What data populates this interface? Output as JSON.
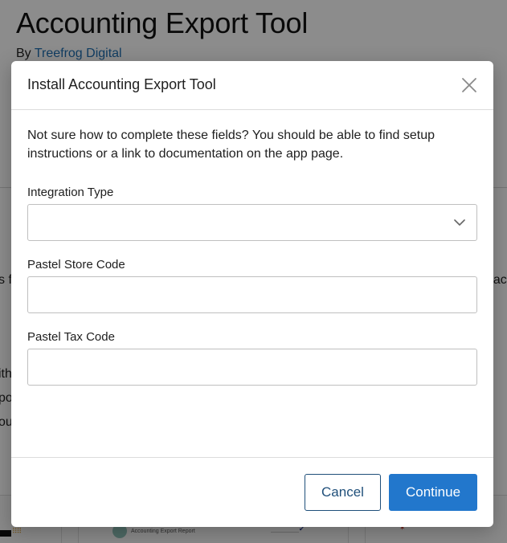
{
  "background": {
    "app_title": "Accounting Export Tool",
    "by_label": "By",
    "developer": "Treefrog Digital",
    "fragments": [
      {
        "text": "s fi",
        "pos": "a"
      },
      {
        "text": "oac",
        "pos": "b"
      },
      {
        "text": "ith",
        "pos": "c"
      },
      {
        "text": "po",
        "pos": "d"
      },
      {
        "text": "ou",
        "pos": "e"
      }
    ],
    "thumbnail_label": "Accounting Export Report"
  },
  "modal": {
    "title": "Install Accounting Export Tool",
    "intro": "Not sure how to complete these fields? You should be able to find setup instructions or a link to documentation on the app page.",
    "fields": {
      "integration_type": {
        "label": "Integration Type",
        "value": ""
      },
      "store_code": {
        "label": "Pastel Store Code",
        "value": ""
      },
      "tax_code": {
        "label": "Pastel Tax Code",
        "value": ""
      }
    },
    "cancel_label": "Cancel",
    "continue_label": "Continue"
  },
  "icons": {
    "close": "close-icon",
    "chevron": "chevron-down-icon"
  },
  "colors": {
    "primary": "#2277cc",
    "link": "#1f6fb2",
    "cancel_border": "#1f4f7a"
  }
}
